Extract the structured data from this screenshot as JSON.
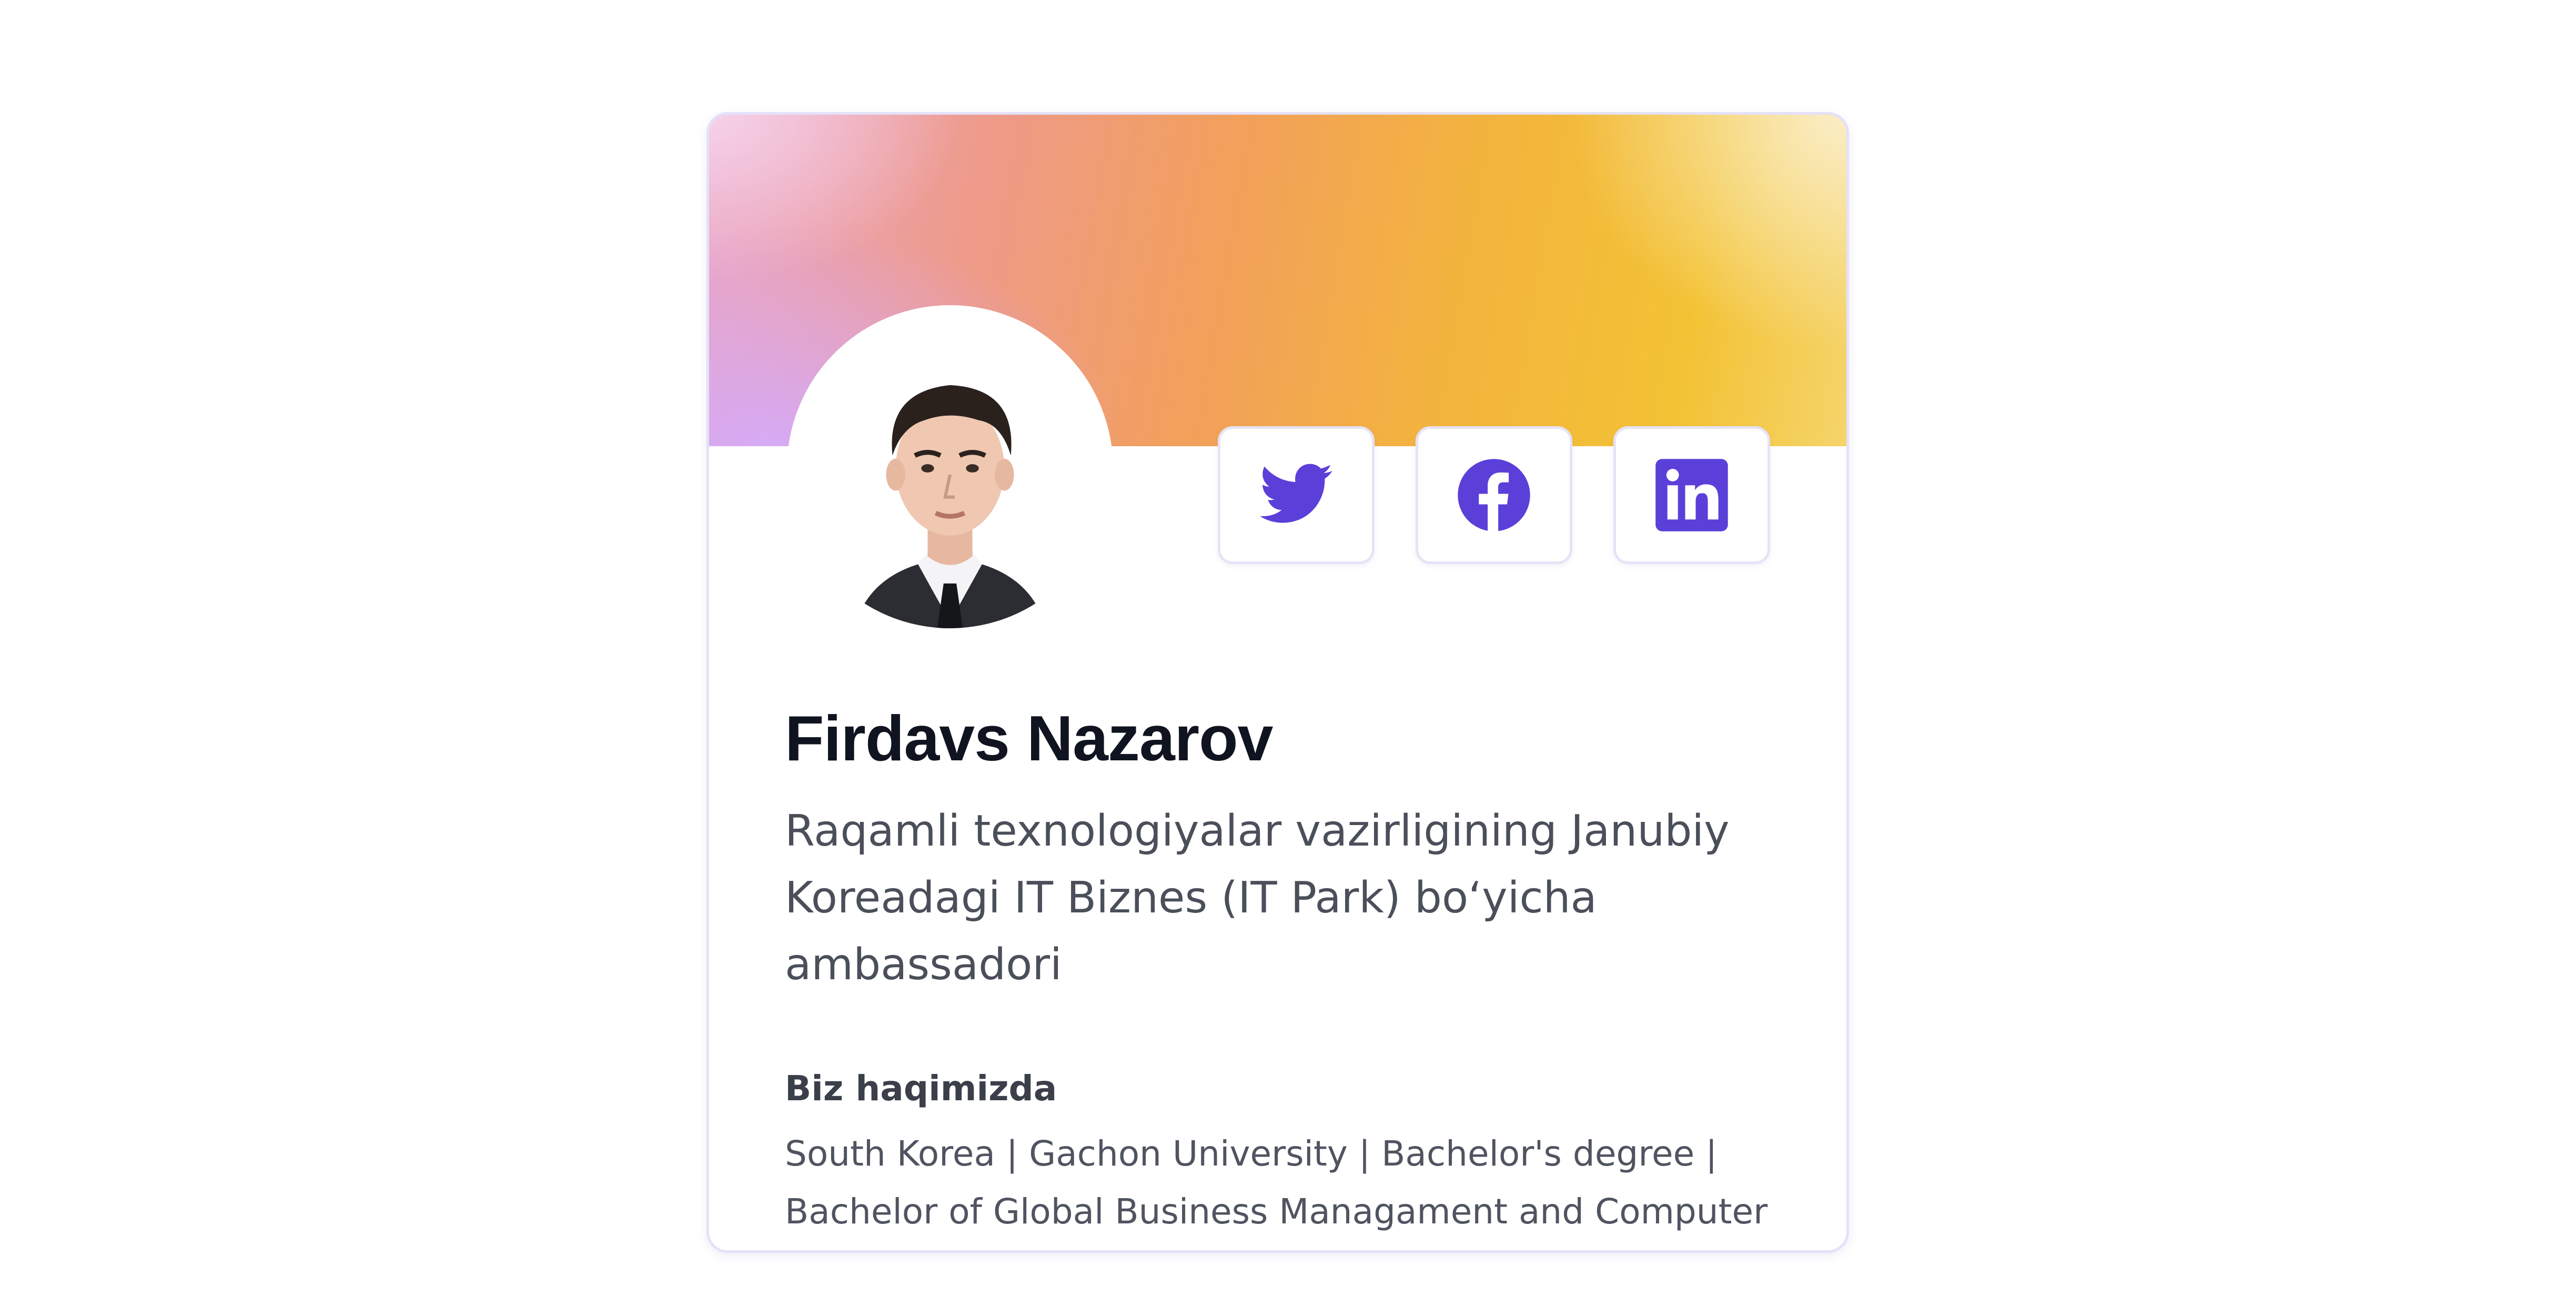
{
  "profile": {
    "name": "Firdavs Nazarov",
    "role": "Raqamli texnologiyalar vazirligining Janubiy Koreadagi IT Biznes (IT Park) bo‘yicha ambassadori",
    "about_title": "Biz haqimizda",
    "about_text": "South Korea | Gachon University | Bachelor's degree | Bachelor of Global Business Managament and Computer Engineering",
    "avatar_alt": "Firdavs Nazarov"
  },
  "social": [
    {
      "name": "twitter",
      "icon": "twitter-bird-icon"
    },
    {
      "name": "facebook",
      "icon": "facebook-icon"
    },
    {
      "name": "linkedin",
      "icon": "linkedin-icon"
    }
  ],
  "colors": {
    "accent": "#5b3fd9",
    "card_border": "#e4e1fa",
    "name_text": "#101420",
    "body_text": "#4a4f5a"
  }
}
